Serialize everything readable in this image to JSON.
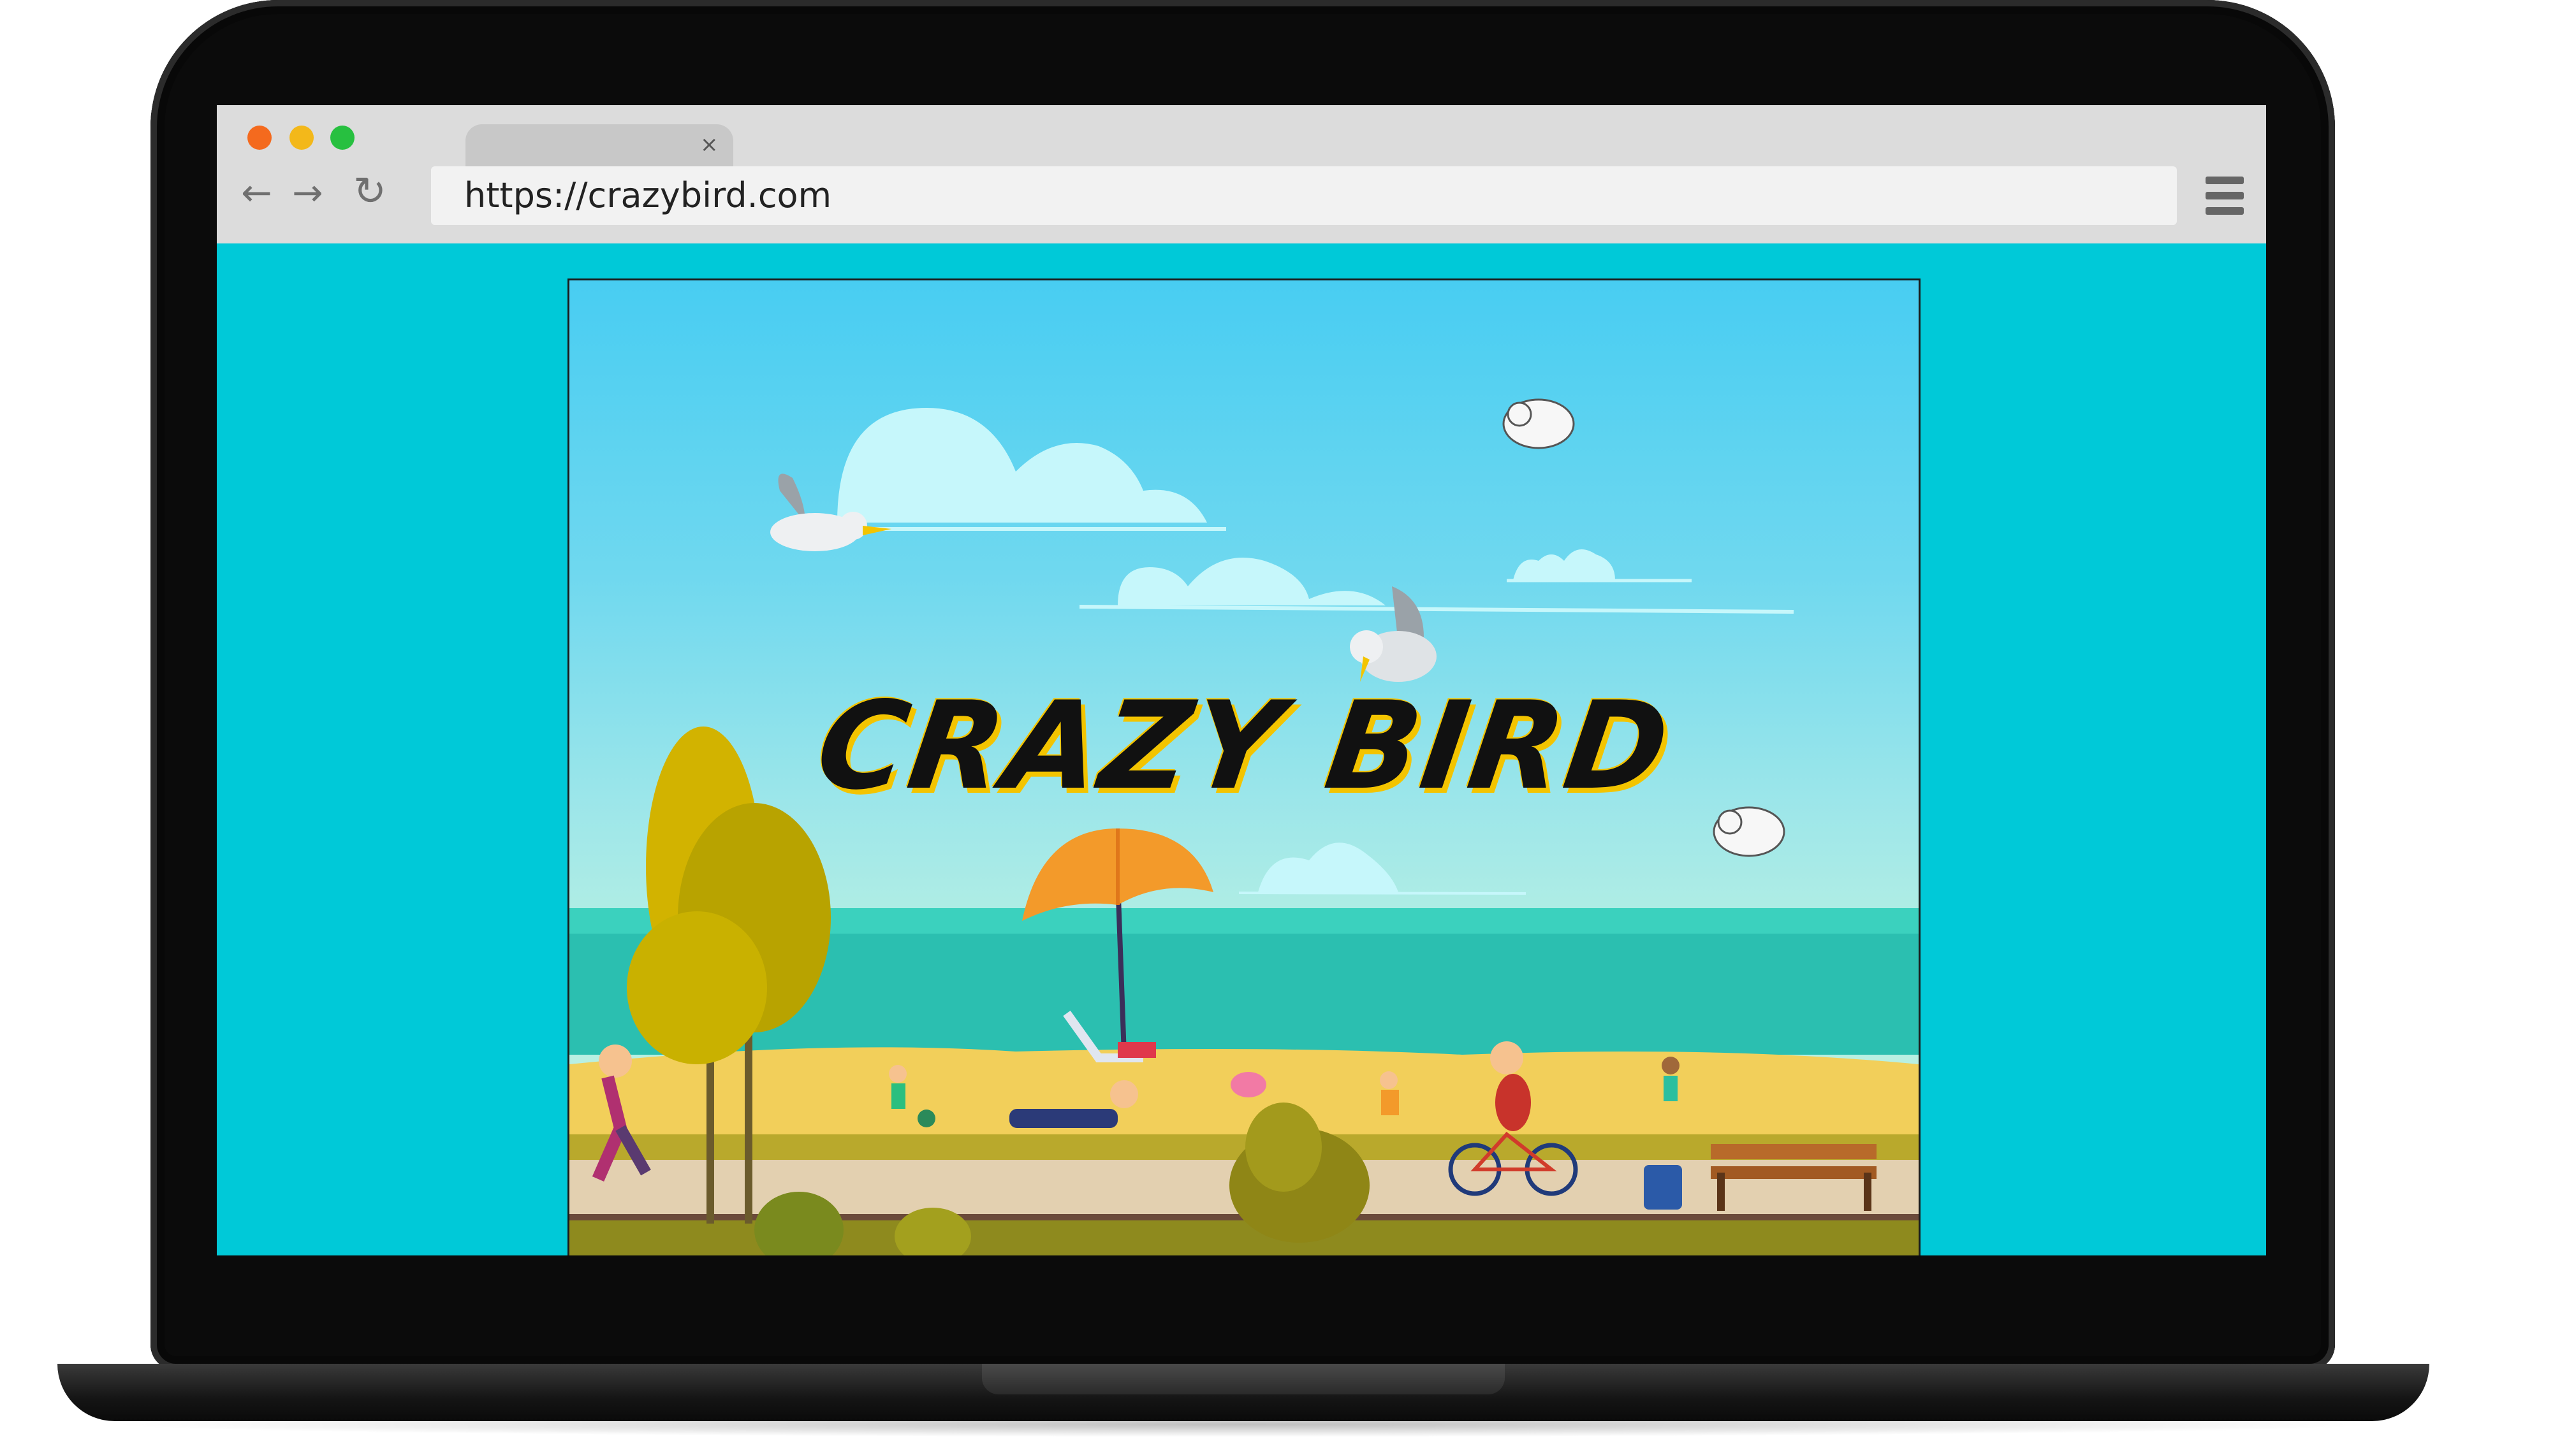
{
  "browser": {
    "url": "https://crazybird.com",
    "tab_close_icon": "×",
    "traffic_light_colors": [
      "#f46a1e",
      "#f3b81a",
      "#27c040"
    ]
  },
  "nav": {
    "back_icon": "←",
    "forward_icon": "→",
    "reload_icon": "↻"
  },
  "game": {
    "title": "CRAZY BIRD"
  },
  "colors": {
    "page_background": "#00c9d8",
    "sea": "#2bbfb0",
    "sand": "#f2cf5a"
  }
}
